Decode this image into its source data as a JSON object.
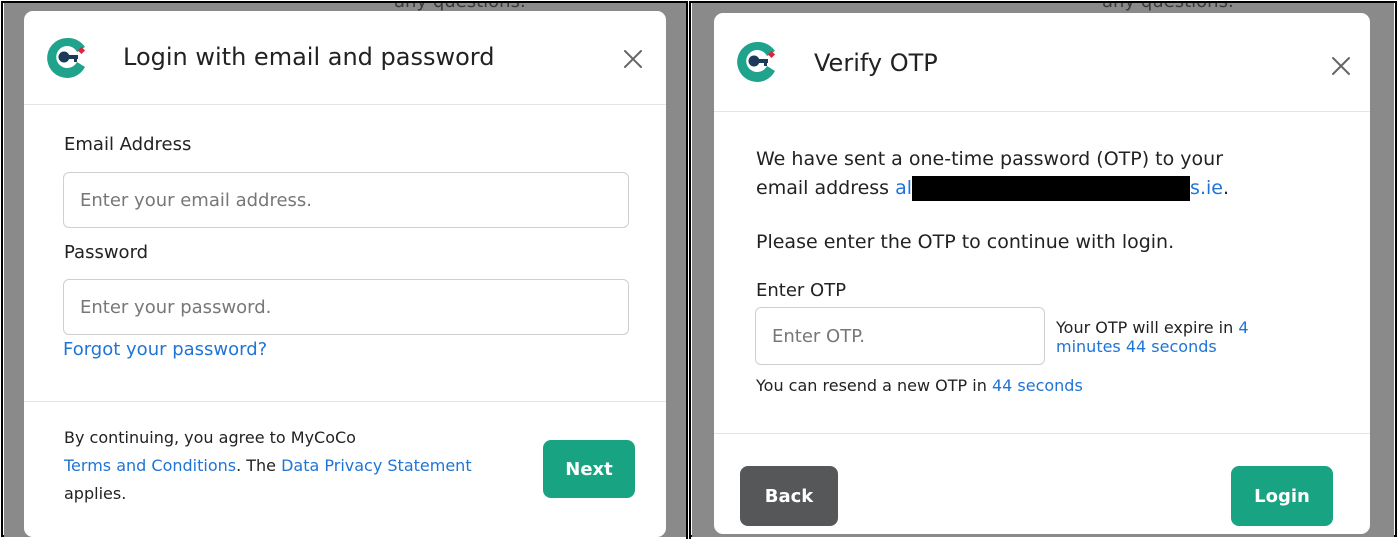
{
  "background_hint_text": "any questions.",
  "login_modal": {
    "title": "Login with email and password",
    "email_label": "Email Address",
    "email_placeholder": "Enter your email address.",
    "password_label": "Password",
    "password_placeholder": "Enter your password.",
    "forgot_link": "Forgot your password?",
    "terms_prefix": "By continuing, you agree to MyCoCo",
    "terms_link": "Terms and Conditions",
    "terms_middle": ". The ",
    "privacy_link": "Data Privacy Statement",
    "terms_suffix": "applies.",
    "next_button": "Next"
  },
  "otp_modal": {
    "title": "Verify OTP",
    "sent_text_line1": "We have sent a one-time password (OTP) to your",
    "sent_text_line2_prefix": "email address ",
    "email_visible_start": "al",
    "email_visible_end": "s.ie",
    "email_period": ".",
    "instruction": "Please enter the OTP to continue with login.",
    "otp_label": "Enter OTP",
    "otp_placeholder": "Enter OTP.",
    "expire_prefix": "Your OTP will expire in ",
    "expire_time": "4 minutes 44 seconds",
    "resend_prefix": "You can resend a new OTP in ",
    "resend_time": "44 seconds",
    "back_button": "Back",
    "login_button": "Login"
  },
  "colors": {
    "primary_button": "#18a483",
    "secondary_button": "#555758",
    "link": "#1f74d6",
    "overlay": "#8a8a8a",
    "logo_teal": "#1fa38c",
    "logo_navy": "#1d3a5b",
    "logo_red": "#d7263d"
  }
}
